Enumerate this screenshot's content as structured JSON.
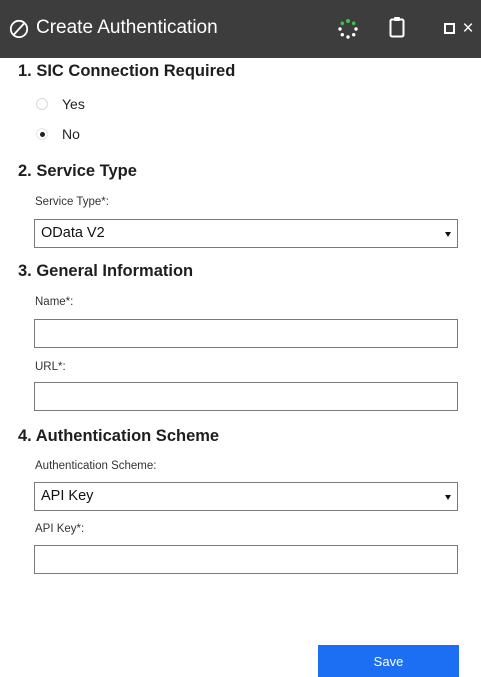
{
  "window": {
    "title": "Create Authentication",
    "icons": [
      "app-logo-icon",
      "loading-spinner-icon",
      "clipboard-icon",
      "restore-icon",
      "close-icon"
    ],
    "close_glyph": "×"
  },
  "sections": {
    "sic": {
      "heading": "1. SIC Connection Required",
      "options": [
        {
          "label": "Yes",
          "selected": false
        },
        {
          "label": "No",
          "selected": true
        }
      ]
    },
    "service": {
      "heading": "2. Service Type",
      "label": "Service Type*:",
      "value": "OData V2"
    },
    "general": {
      "heading": "3. General Information",
      "name_label": "Name*:",
      "name_value": "",
      "url_label": "URL*:",
      "url_value": ""
    },
    "auth": {
      "heading": "4. Authentication Scheme",
      "scheme_label": "Authentication Scheme:",
      "scheme_value": "API Key",
      "apikey_label": "API Key*:",
      "apikey_value": ""
    }
  },
  "footer": {
    "save_label": "Save"
  },
  "colors": {
    "titlebar": "#3d3d3d",
    "save_button": "#1c6ff2",
    "spinner": "#3fbf55"
  }
}
